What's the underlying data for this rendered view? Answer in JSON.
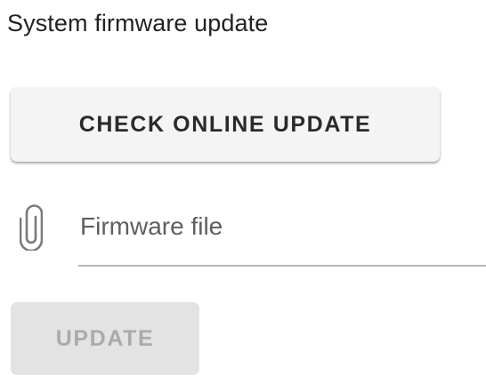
{
  "section": {
    "title": "System firmware update"
  },
  "actions": {
    "check_online_label": "CHECK ONLINE UPDATE",
    "update_label": "UPDATE",
    "update_enabled": false
  },
  "file_input": {
    "placeholder": "Firmware file",
    "value": "",
    "icon": "paperclip-icon"
  },
  "colors": {
    "button_bg": "#f4f4f4",
    "disabled_button_bg": "#e3e3e3",
    "disabled_text": "#aaaaaa",
    "underline": "#b5b5b5"
  }
}
